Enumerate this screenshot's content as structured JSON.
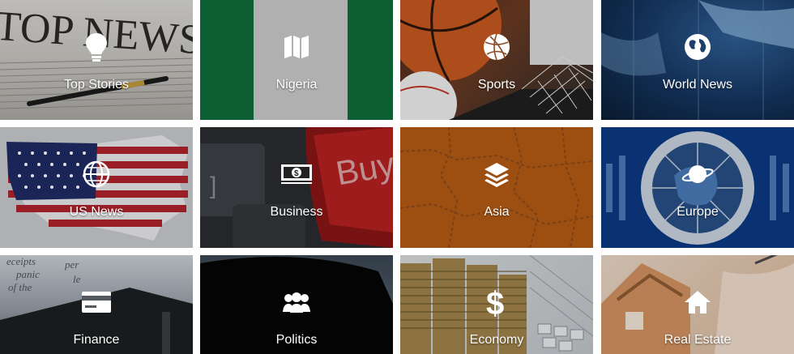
{
  "tiles": [
    {
      "label": "Top Stories",
      "icon": "lightbulb-icon"
    },
    {
      "label": "Nigeria",
      "icon": "map-icon"
    },
    {
      "label": "Sports",
      "icon": "basketball-icon"
    },
    {
      "label": "World News",
      "icon": "globe-icon"
    },
    {
      "label": "US News",
      "icon": "globe-grid-icon"
    },
    {
      "label": "Business",
      "icon": "money-icon"
    },
    {
      "label": "Asia",
      "icon": "layers-icon"
    },
    {
      "label": "Europe",
      "icon": "planet-icon"
    },
    {
      "label": "Finance",
      "icon": "credit-card-icon"
    },
    {
      "label": "Politics",
      "icon": "users-icon"
    },
    {
      "label": "Economy",
      "icon": "dollar-icon"
    },
    {
      "label": "Real Estate",
      "icon": "home-icon"
    }
  ],
  "colors": {
    "label_text": "#ffffff",
    "nigeria_green": "#0f6b3a",
    "nigeria_white": "#c9c9c9",
    "asia_orange": "#b35a14",
    "europe_blue": "#0c3a83",
    "world_blue": "#0e2d52"
  },
  "decor": {
    "top_stories_headline": "TOP NEWS",
    "business_key_text": "Buy"
  }
}
